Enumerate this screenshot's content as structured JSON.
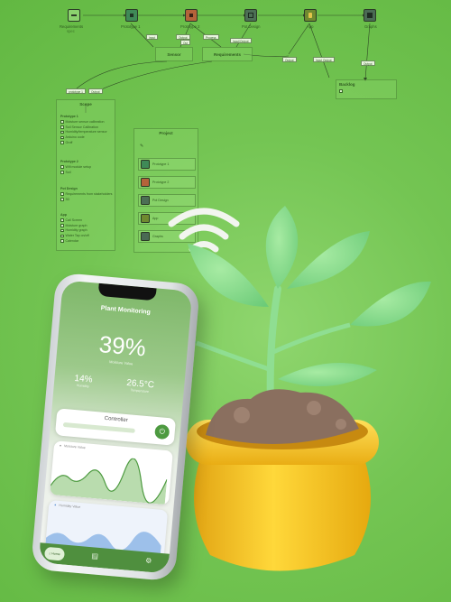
{
  "diagram": {
    "nodes": [
      {
        "label": "Requirements",
        "sublabel": "spec",
        "color": "#8bd26e",
        "icon": "requirements-icon"
      },
      {
        "label": "Prototype 1",
        "color": "#3f8a57",
        "icon": "chip-icon"
      },
      {
        "label": "Prototype 2",
        "color": "#b4633a",
        "icon": "chip-icon"
      },
      {
        "label": "Pot Design",
        "color": "#4c6f55",
        "icon": "box-icon"
      },
      {
        "label": "App",
        "color": "#6f8a2f",
        "icon": "app-icon"
      },
      {
        "label": "Graphs",
        "color": "#4a6a54",
        "icon": "graph-icon"
      }
    ],
    "mid_nodes": [
      {
        "label": "Sensor"
      },
      {
        "label": "Requirements"
      }
    ],
    "edge_tags": [
      "Input",
      "Output",
      "Out",
      "Process",
      "Input/Output",
      "Output",
      "Input Output",
      "Output",
      "prototype 1",
      "Output"
    ],
    "scope_panel": {
      "title": "Scope",
      "groups": [
        {
          "title": "Prototype 1",
          "items": [
            "Moisture sensor calibration",
            "Soil Sensor Calibration",
            "Humidity/temperature sensor",
            "Arduino code",
            "Groff"
          ]
        },
        {
          "title": "Prototype 2",
          "items": [
            "Wifi module setup",
            "Soil"
          ]
        },
        {
          "title": "Pot Design",
          "items": [
            "Requirements from stakeholders",
            "3D"
          ]
        },
        {
          "title": "App",
          "items": [
            "Call Screen",
            "Moisture graph",
            "Humidity graph",
            "Water Tap on/off",
            "Calendar"
          ]
        }
      ]
    },
    "project_panel": {
      "title": "Project",
      "rows": [
        {
          "label": "Prototype 1",
          "color": "#3f8a57"
        },
        {
          "label": "Prototype 2",
          "color": "#b4633a"
        },
        {
          "label": "Pot Design",
          "color": "#4c6f55"
        },
        {
          "label": "App",
          "color": "#6f8a2f"
        },
        {
          "label": "Graphs",
          "color": "#4a6a54"
        }
      ]
    },
    "backlog_panel": {
      "title": "Backlog"
    }
  },
  "phone": {
    "screen_title": "Plant Monitoring",
    "moisture_value": "39%",
    "moisture_label": "Moisture Value",
    "humidity_value": "14%",
    "humidity_label": "Humidity",
    "temperature_value": "26.5°C",
    "temperature_label": "Temperature",
    "controller_title": "Controller",
    "moisture_card_title": "Moisture Value",
    "humidity_card_title": "Humidity Value",
    "nav_home_label": "Home",
    "accent": "#4d9a40"
  },
  "icons": [
    "wifi-icon",
    "power-icon",
    "home-icon",
    "calendar-icon",
    "gear-icon",
    "droplet-icon"
  ]
}
